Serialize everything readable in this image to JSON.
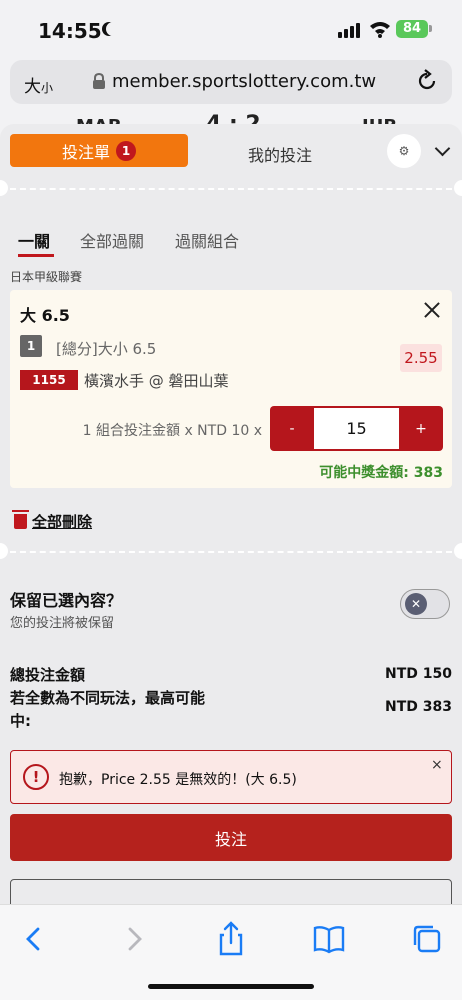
{
  "status": {
    "time": "14:55",
    "battery": "84"
  },
  "browser": {
    "text_size": "大",
    "text_size_small": "小",
    "url": "member.sportslottery.com.tw"
  },
  "scoreboard": {
    "home": "MAB",
    "score": "4 : 2",
    "away": "IUB"
  },
  "betslip": {
    "tab_bet_label": "投注單",
    "tab_bet_count": "1",
    "tab_mybets_label": "我的投注",
    "subtabs": [
      "一關",
      "全部過關",
      "過關組合"
    ],
    "league": "日本甲級聯賽",
    "selection": {
      "title": "大 6.5",
      "number": "1",
      "market": "[總分]大小 6.5",
      "odds": "2.55",
      "match_code": "1155",
      "match_name": "橫濱水手 @ 磐田山葉",
      "stake_label": "1 組合投注金額 x NTD 10 x",
      "stake_minus": "-",
      "stake_value": "15",
      "stake_plus": "+",
      "potential_win": "可能中獎金額: 383"
    },
    "delete_all": "全部刪除",
    "keep": {
      "title": "保留已選內容？",
      "subtitle": "您的投注將被保留"
    },
    "summary": {
      "total_label": "總投注金額",
      "total_value": "NTD 150",
      "max_label_1": "若全數為不同玩法，最高可能",
      "max_label_2": "中:",
      "max_value": "NTD 383"
    },
    "error": {
      "icon": "!",
      "message": "抱歉，Price 2.55 是無效的！(大 6.5)",
      "close": "×"
    },
    "submit_label": "投注"
  },
  "colors": {
    "accent_orange": "#f2760e",
    "brand_red": "#b5161c",
    "win_green": "#3d8f2d"
  }
}
